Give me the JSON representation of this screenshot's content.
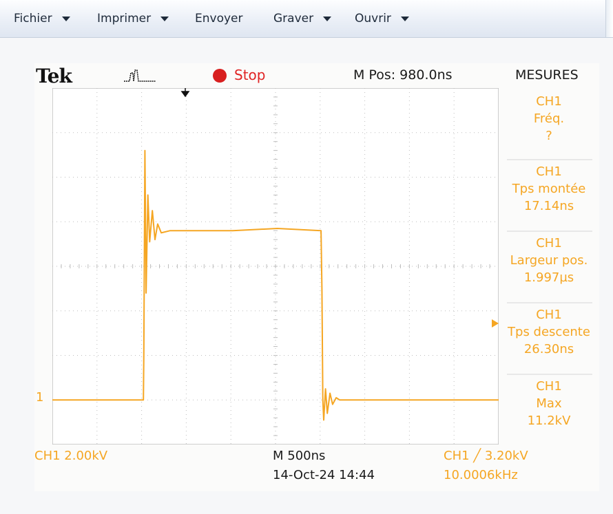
{
  "toolbar": {
    "items": [
      {
        "label": "Fichier",
        "dropdown": true
      },
      {
        "label": "Imprimer",
        "dropdown": true
      },
      {
        "label": "Envoyer",
        "dropdown": false
      },
      {
        "label": "Graver",
        "dropdown": true
      },
      {
        "label": "Ouvrir",
        "dropdown": true
      }
    ]
  },
  "scope": {
    "brand": "Tek",
    "status": "Stop",
    "m_pos": "M Pos: 980.0ns",
    "measures_title": "MESURES",
    "measures": [
      {
        "channel": "CH1",
        "name": "Fréq.",
        "value": "?"
      },
      {
        "channel": "CH1",
        "name": "Tps montée",
        "value": "17.14ns"
      },
      {
        "channel": "CH1",
        "name": "Largeur pos.",
        "value": "1.997µs"
      },
      {
        "channel": "CH1",
        "name": "Tps descente",
        "value": "26.30ns"
      },
      {
        "channel": "CH1",
        "name": "Max",
        "value": "11.2kV"
      }
    ],
    "ch_marker": "1",
    "ch_scale": "CH1  2.00kV",
    "timebase": "M 500ns",
    "datetime": "14-Oct-24 14:44",
    "trigger": "CH1 ╱ 3.20kV",
    "trigger_freq": "10.0006kHz",
    "colors": {
      "trace": "#f5a623",
      "grid": "#bdbdbd",
      "stop": "#d81f1f",
      "background": "#fbfbfa"
    }
  },
  "chart_data": {
    "type": "line",
    "title": "",
    "xlabel": "",
    "ylabel": "",
    "x_unit": "ns",
    "y_unit": "kV",
    "xlim": [
      -1020,
      3980
    ],
    "ylim": [
      -2.0,
      14.0
    ],
    "grid": true,
    "series": [
      {
        "name": "CH1",
        "x": [
          -1020,
          0,
          5,
          17,
          30,
          50,
          70,
          100,
          130,
          160,
          200,
          300,
          500,
          1000,
          1500,
          1990,
          2000,
          2010,
          2020,
          2040,
          2060,
          2090,
          2120,
          2160,
          2200,
          2300,
          2500,
          3000,
          3980
        ],
        "y": [
          0,
          0,
          2.0,
          11.2,
          4.8,
          9.2,
          7.1,
          8.5,
          7.2,
          7.9,
          7.5,
          7.6,
          7.6,
          7.6,
          7.7,
          7.6,
          5.0,
          0.0,
          -0.9,
          0.5,
          -0.6,
          0.3,
          -0.2,
          0.1,
          0.0,
          0.0,
          0.0,
          0.0,
          0.0
        ]
      }
    ]
  }
}
